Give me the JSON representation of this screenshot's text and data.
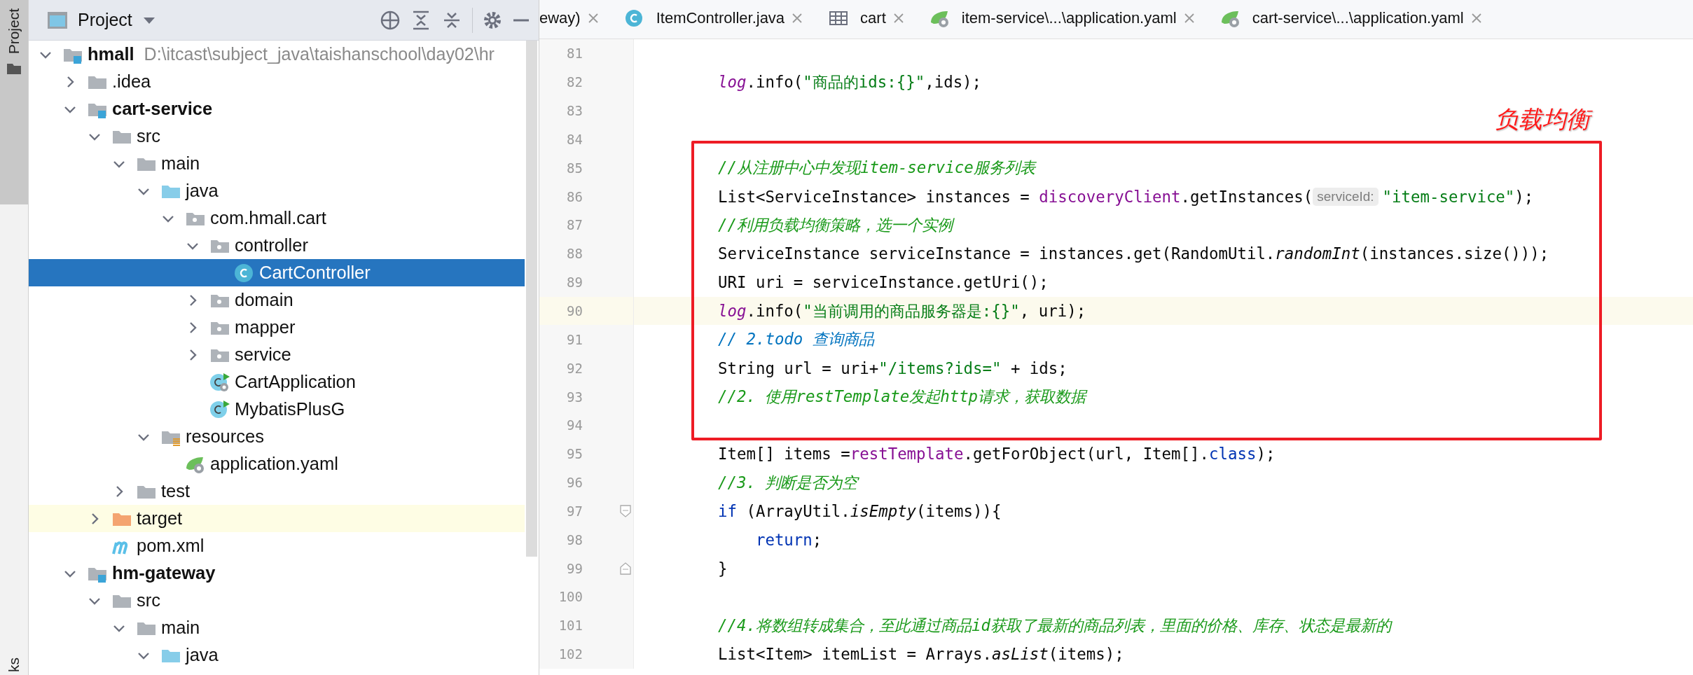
{
  "tool_stripe": {
    "top_label": "Project",
    "bottom_label": "ks"
  },
  "project_panel": {
    "title": "Project",
    "tree": [
      {
        "label": "hmall",
        "kind": "module",
        "path": "D:\\itcast\\subject_java\\taishanschool\\day02\\hr",
        "expanded": true,
        "selected": false,
        "highlighted": false,
        "children": [
          {
            "label": ".idea",
            "kind": "folder",
            "expanded": false,
            "selected": false,
            "highlighted": false
          },
          {
            "label": "cart-service",
            "kind": "module",
            "expanded": true,
            "selected": false,
            "highlighted": false,
            "children": [
              {
                "label": "src",
                "kind": "folder",
                "expanded": true,
                "selected": false,
                "highlighted": false,
                "children": [
                  {
                    "label": "main",
                    "kind": "folder",
                    "expanded": true,
                    "selected": false,
                    "highlighted": false,
                    "children": [
                      {
                        "label": "java",
                        "kind": "source",
                        "expanded": true,
                        "selected": false,
                        "highlighted": false,
                        "children": [
                          {
                            "label": "com.hmall.cart",
                            "kind": "package",
                            "expanded": true,
                            "selected": false,
                            "highlighted": false,
                            "children": [
                              {
                                "label": "controller",
                                "kind": "package",
                                "expanded": true,
                                "selected": false,
                                "highlighted": false,
                                "children": [
                                  {
                                    "label": "CartController",
                                    "kind": "class",
                                    "selected": true,
                                    "highlighted": false
                                  }
                                ]
                              },
                              {
                                "label": "domain",
                                "kind": "package",
                                "expanded": false,
                                "selected": false,
                                "highlighted": false
                              },
                              {
                                "label": "mapper",
                                "kind": "package",
                                "expanded": false,
                                "selected": false,
                                "highlighted": false
                              },
                              {
                                "label": "service",
                                "kind": "package",
                                "expanded": false,
                                "selected": false,
                                "highlighted": false
                              },
                              {
                                "label": "CartApplication",
                                "kind": "spring-class",
                                "selected": false,
                                "highlighted": false
                              },
                              {
                                "label": "MybatisPlusG",
                                "kind": "runnable-class",
                                "selected": false,
                                "highlighted": false
                              }
                            ]
                          }
                        ]
                      },
                      {
                        "label": "resources",
                        "kind": "resources",
                        "expanded": true,
                        "selected": false,
                        "highlighted": false,
                        "children": [
                          {
                            "label": "application.yaml",
                            "kind": "yaml",
                            "selected": false,
                            "highlighted": false
                          }
                        ]
                      }
                    ]
                  },
                  {
                    "label": "test",
                    "kind": "folder",
                    "expanded": false,
                    "selected": false,
                    "highlighted": false
                  }
                ]
              },
              {
                "label": "target",
                "kind": "excluded",
                "expanded": false,
                "selected": false,
                "highlighted": true
              },
              {
                "label": "pom.xml",
                "kind": "maven",
                "selected": false,
                "highlighted": false
              }
            ]
          },
          {
            "label": "hm-gateway",
            "kind": "module",
            "expanded": true,
            "selected": false,
            "highlighted": false,
            "children": [
              {
                "label": "src",
                "kind": "folder",
                "expanded": true,
                "selected": false,
                "highlighted": false,
                "children": [
                  {
                    "label": "main",
                    "kind": "folder",
                    "expanded": true,
                    "selected": false,
                    "highlighted": false,
                    "children": [
                      {
                        "label": "java",
                        "kind": "source",
                        "expanded": true,
                        "selected": false,
                        "highlighted": false
                      }
                    ]
                  }
                ]
              }
            ]
          }
        ]
      }
    ]
  },
  "editor": {
    "tabs": [
      {
        "label": "eway)",
        "kind": "plain",
        "selected": false
      },
      {
        "label": "ItemController.java",
        "kind": "class",
        "selected": false
      },
      {
        "label": "cart",
        "kind": "table",
        "selected": false
      },
      {
        "label": "item-service\\...\\application.yaml",
        "kind": "yaml",
        "selected": false
      },
      {
        "label": "cart-service\\...\\application.yaml",
        "kind": "yaml",
        "selected": false
      }
    ],
    "annotation": {
      "label": "负载均衡"
    },
    "lines": [
      {
        "number": "81",
        "current": false
      },
      {
        "number": "82",
        "current": false,
        "tokens": [
          {
            "kind": "static",
            "text": "log"
          },
          {
            "kind": "plain",
            "text": ".info("
          },
          {
            "kind": "string",
            "text": "\"商品的ids:{}\""
          },
          {
            "kind": "plain",
            "text": ",ids);"
          }
        ]
      },
      {
        "number": "83",
        "current": false
      },
      {
        "number": "84",
        "current": false
      },
      {
        "number": "85",
        "current": false,
        "tokens": [
          {
            "kind": "comment",
            "text": "//从注册中心中发现item-service服务列表"
          }
        ]
      },
      {
        "number": "86",
        "current": false,
        "tokens": [
          {
            "kind": "plain",
            "text": "List<ServiceInstance> instances = "
          },
          {
            "kind": "field",
            "text": "discoveryClient"
          },
          {
            "kind": "plain",
            "text": ".getInstances("
          },
          {
            "kind": "hint",
            "text": "serviceId:"
          },
          {
            "kind": "string",
            "text": "\"item-service\""
          },
          {
            "kind": "plain",
            "text": ");"
          }
        ]
      },
      {
        "number": "87",
        "current": false,
        "tokens": [
          {
            "kind": "comment",
            "text": "//利用负载均衡策略，选一个实例"
          }
        ]
      },
      {
        "number": "88",
        "current": false,
        "tokens": [
          {
            "kind": "plain",
            "text": "ServiceInstance serviceInstance = instances.get(RandomUtil."
          },
          {
            "kind": "italic",
            "text": "randomInt"
          },
          {
            "kind": "plain",
            "text": "(instances.size()));"
          }
        ]
      },
      {
        "number": "89",
        "current": false,
        "tokens": [
          {
            "kind": "plain",
            "text": "URI uri = serviceInstance.getUri();"
          }
        ]
      },
      {
        "number": "90",
        "current": true,
        "tokens": [
          {
            "kind": "static",
            "text": "log"
          },
          {
            "kind": "plain",
            "text": ".info("
          },
          {
            "kind": "string",
            "text": "\"当前调用的商品服务器是:{}\""
          },
          {
            "kind": "plain",
            "text": ", uri);"
          }
        ]
      },
      {
        "number": "91",
        "current": false,
        "tokens": [
          {
            "kind": "todo",
            "text": "// 2.todo 查询商品"
          }
        ]
      },
      {
        "number": "92",
        "current": false,
        "tokens": [
          {
            "kind": "plain",
            "text": "String url = uri+"
          },
          {
            "kind": "string",
            "text": "\"/items?ids=\""
          },
          {
            "kind": "plain",
            "text": " + ids;"
          }
        ]
      },
      {
        "number": "93",
        "current": false,
        "tokens": [
          {
            "kind": "comment",
            "text": "//2. 使用restTemplate发起http请求，获取数据"
          }
        ]
      },
      {
        "number": "94",
        "current": false
      },
      {
        "number": "95",
        "current": false,
        "tokens": [
          {
            "kind": "plain",
            "text": "Item[] items ="
          },
          {
            "kind": "field",
            "text": "restTemplate"
          },
          {
            "kind": "plain",
            "text": ".getForObject(url, Item[]."
          },
          {
            "kind": "keyword",
            "text": "class"
          },
          {
            "kind": "plain",
            "text": ");"
          }
        ]
      },
      {
        "number": "96",
        "current": false,
        "tokens": [
          {
            "kind": "comment",
            "text": "//3. 判断是否为空"
          }
        ]
      },
      {
        "number": "97",
        "current": false,
        "fold_start": true,
        "tokens": [
          {
            "kind": "keyword",
            "text": "if"
          },
          {
            "kind": "plain",
            "text": " (ArrayUtil."
          },
          {
            "kind": "italic",
            "text": "isEmpty"
          },
          {
            "kind": "plain",
            "text": "(items)){"
          }
        ]
      },
      {
        "number": "98",
        "current": false,
        "tokens": [
          {
            "kind": "keyword",
            "text": "    return"
          },
          {
            "kind": "plain",
            "text": ";"
          }
        ]
      },
      {
        "number": "99",
        "current": false,
        "fold_end": true,
        "tokens": [
          {
            "kind": "plain",
            "text": "}"
          }
        ]
      },
      {
        "number": "100",
        "current": false
      },
      {
        "number": "101",
        "current": false,
        "tokens": [
          {
            "kind": "comment",
            "text": "//4.将数组转成集合，至此通过商品id获取了最新的商品列表，里面的价格、库存、状态是最新的"
          }
        ]
      },
      {
        "number": "102",
        "current": false,
        "tokens": [
          {
            "kind": "plain",
            "text": "List<Item> itemList = Arrays."
          },
          {
            "kind": "italic",
            "text": "asList"
          },
          {
            "kind": "plain",
            "text": "(items);"
          }
        ]
      }
    ]
  }
}
